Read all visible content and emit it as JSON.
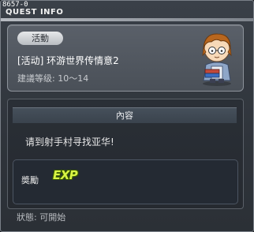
{
  "window": {
    "dev_id": "8657-0",
    "title": "QUEST INFO"
  },
  "quest": {
    "category": "活動",
    "name": "[活动] 环游世界传情意2",
    "level_range": "建議等级: 10～14",
    "npc_icon": "npc-portrait-icon"
  },
  "content": {
    "header": "內容",
    "description": "请到射手村寻找亚华!"
  },
  "reward": {
    "label": "奬勵",
    "exp_text": "EXP"
  },
  "status": {
    "text": "狀態: 可開始"
  },
  "colors": {
    "exp": "#d9f545",
    "title_bar": "#b8bcc2"
  }
}
